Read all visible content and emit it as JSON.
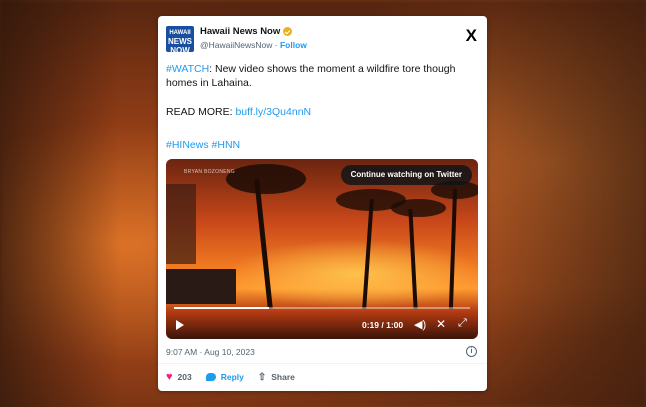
{
  "account": {
    "logo_line1": "HAWAII",
    "logo_line2": "NEWS",
    "logo_line3": "NOW",
    "name": "Hawaii News Now",
    "handle": "@HawaiiNewsNow",
    "separator": " · ",
    "follow_label": "Follow"
  },
  "x_logo": "X",
  "tweet": {
    "hashtag_watch": "#WATCH",
    "body": ": New video shows the moment a wildfire tore though homes in Lahaina.",
    "read_more_label": "READ MORE: ",
    "read_more_link": "buff.ly/3Qu4nnN",
    "hashtag_hinews": "#HINews",
    "hashtag_hnn": "#HNN"
  },
  "video": {
    "watermark": "BRYAN BOZONENG",
    "continue_label": "Continue watching on Twitter",
    "time": "0:19 / 1:00",
    "progress": 0.32,
    "play_icon": "play-icon",
    "volume_icon": "volume-icon",
    "mute_icon": "x-icon",
    "fullscreen_icon": "fullscreen-icon"
  },
  "meta": {
    "timestamp": "9:07 AM · Aug 10, 2023"
  },
  "actions": {
    "likes": "203",
    "reply_label": "Reply",
    "share_label": "Share"
  },
  "colors": {
    "link": "#1d9bf0",
    "like": "#f91880",
    "verified": "#e8b125"
  }
}
